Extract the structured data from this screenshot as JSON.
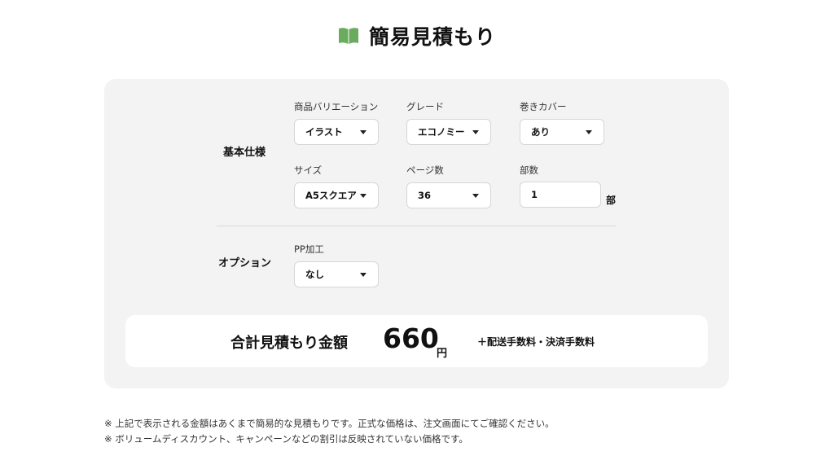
{
  "page": {
    "title": "簡易見積もり",
    "title_icon": "book-icon",
    "accent_color": "#6aab5e"
  },
  "basic": {
    "label": "基本仕様",
    "variation": {
      "label": "商品バリエーション",
      "value": "イラスト"
    },
    "grade": {
      "label": "グレード",
      "value": "エコノミー"
    },
    "cover": {
      "label": "巻きカバー",
      "value": "あり"
    },
    "size": {
      "label": "サイズ",
      "value": "A5スクエア"
    },
    "pages": {
      "label": "ページ数",
      "value": "36"
    },
    "copies": {
      "label": "部数",
      "value": "1",
      "unit": "部"
    }
  },
  "options": {
    "label": "オプション",
    "pp": {
      "label": "PP加工",
      "value": "なし"
    }
  },
  "total": {
    "label": "合計見積もり金額",
    "value": "660",
    "unit": "円",
    "note": "＋配送手数料・決済手数料"
  },
  "notes": [
    "※ 上記で表示される金額はあくまで簡易的な見積もりです。正式な価格は、注文画面にてご確認ください。",
    "※ ボリュームディスカウント、キャンペーンなどの割引は反映されていない価格です。"
  ]
}
